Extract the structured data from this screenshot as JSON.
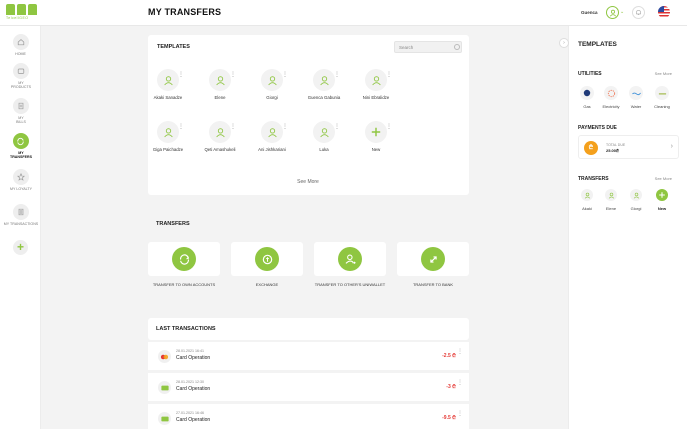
{
  "header": {
    "logo_text": "TelcellGEO",
    "title": "MY TRANSFERS",
    "user_name": "Guenca"
  },
  "sidebar": {
    "items": [
      {
        "label": "HOME",
        "icon": "home-icon"
      },
      {
        "label": "MY PRODUCTS",
        "icon": "wallet-icon"
      },
      {
        "label": "MY BILLS",
        "icon": "bill-icon"
      },
      {
        "label": "MY TRANSFERS",
        "icon": "transfer-icon"
      },
      {
        "label": "MY LOYALTY",
        "icon": "star-icon"
      },
      {
        "label": "MY TRANSACTIONS",
        "icon": "document-icon"
      }
    ]
  },
  "templates": {
    "title": "TEMPLATES",
    "search_placeholder": "Search",
    "items": [
      {
        "name": "Akaki Sanadze"
      },
      {
        "name": "Elene"
      },
      {
        "name": "Giorgi"
      },
      {
        "name": "Guenca Gabunia"
      },
      {
        "name": "Nini Ebralidze"
      },
      {
        "name": "Giga Paichadze"
      },
      {
        "name": "Qeti Amashukeli"
      },
      {
        "name": "Ani Jishkariani"
      },
      {
        "name": "Luka"
      },
      {
        "name": "New"
      }
    ],
    "see_more": "See More"
  },
  "transfers": {
    "title": "TRANSFERS",
    "items": [
      {
        "label": "TRANSFER to OWN ACCOUNTS"
      },
      {
        "label": "EXCHANGE"
      },
      {
        "label": "TRANSFER to OTHER'S UNIWALLET"
      },
      {
        "label": "TRANSFER to BANK"
      }
    ]
  },
  "last_transactions": {
    "title": "LAST TRANSACTIONS",
    "items": [
      {
        "date": "28.01.2021 16:41",
        "name": "Card Operation",
        "amount": "-2.5 ₾"
      },
      {
        "date": "28.01.2021 12:30",
        "name": "Card Operation",
        "amount": "-3 ₾"
      },
      {
        "date": "27.01.2021 16:46",
        "name": "Card Operation",
        "amount": "-9.5 ₾"
      }
    ]
  },
  "right_panel": {
    "title": "TEMPLATES",
    "utilities": {
      "title": "UTILITIES",
      "see_more": "See More",
      "items": [
        {
          "label": "Gas"
        },
        {
          "label": "Electricity"
        },
        {
          "label": "Water"
        },
        {
          "label": "Cleaning"
        }
      ]
    },
    "payments_due": {
      "title": "PAYMENTS DUE",
      "icon_text": "₾",
      "label": "TOTAL DUE",
      "amount": "25.00₾"
    },
    "transfers": {
      "title": "TRANSFERS",
      "see_more": "See More",
      "items": [
        {
          "label": "Akaki"
        },
        {
          "label": "Elene"
        },
        {
          "label": "Giorgi"
        },
        {
          "label": "New"
        }
      ]
    }
  },
  "colors": {
    "accent": "#8fc641",
    "negative": "#e53935",
    "due": "#f4a01c"
  }
}
